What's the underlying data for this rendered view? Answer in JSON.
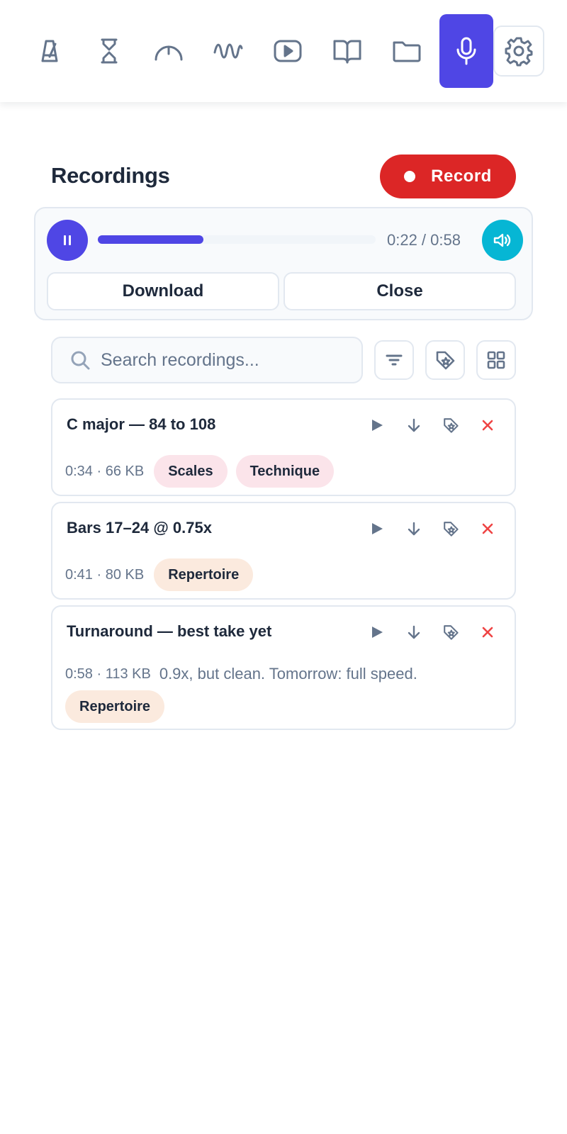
{
  "nav": {
    "items": [
      {
        "icon": "metronome-icon"
      },
      {
        "icon": "hourglass-icon"
      },
      {
        "icon": "gauge-icon"
      },
      {
        "icon": "wave-icon"
      },
      {
        "icon": "video-icon"
      },
      {
        "icon": "book-icon"
      },
      {
        "icon": "folder-icon"
      },
      {
        "icon": "microphone-icon",
        "active": true
      },
      {
        "icon": "gear-icon"
      }
    ]
  },
  "header": {
    "title": "Recordings",
    "record_label": "Record"
  },
  "player": {
    "time": "0:22 / 0:58",
    "progress": 0.38,
    "download_label": "Download",
    "close_label": "Close"
  },
  "search": {
    "placeholder": "Search recordings..."
  },
  "recordings": [
    {
      "title": "C major — 84 to 108",
      "meta": "0:34 · 66 KB",
      "tags": [
        "Scales",
        "Technique"
      ]
    },
    {
      "title": "Bars 17–24 @ 0.75x",
      "meta": "0:41 · 80 KB",
      "tags": [
        "Repertoire"
      ]
    },
    {
      "title": "Turnaround — best take yet",
      "meta": "0:58 · 113 KB",
      "note": "0.9x, but clean. Tomorrow: full speed.",
      "tags": [
        "Repertoire"
      ]
    }
  ],
  "colors": {
    "accent": "#4f46e5",
    "record": "#dc2626",
    "volume": "#06b6d4",
    "delete": "#ef4444",
    "icon": "#64748b"
  }
}
